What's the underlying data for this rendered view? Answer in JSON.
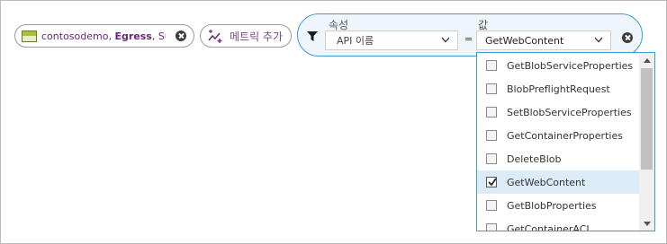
{
  "metric_pill": {
    "resource": "contosodemo, ",
    "metric": "Egress",
    "aggregation": ", Sum",
    "icon": "storage-account-icon",
    "remove_icon": "close-icon"
  },
  "add_metric": {
    "label": "메트릭 추가",
    "icon": "add-metric-sparkle-icon"
  },
  "filter": {
    "icon": "funnel-icon",
    "property_label": "속성",
    "value_label": "값",
    "property_value": "API 이름",
    "operator": "=",
    "value_selected": "GetWebContent",
    "remove_icon": "close-icon"
  },
  "dropdown": {
    "items": [
      {
        "label": "GetBlobServiceProperties",
        "checked": false
      },
      {
        "label": "BlobPreflightRequest",
        "checked": false
      },
      {
        "label": "SetBlobServiceProperties",
        "checked": false
      },
      {
        "label": "GetContainerProperties",
        "checked": false
      },
      {
        "label": "DeleteBlob",
        "checked": false
      },
      {
        "label": "GetWebContent",
        "checked": true
      },
      {
        "label": "GetBlobProperties",
        "checked": false
      },
      {
        "label": "GetContainerACL",
        "checked": false
      }
    ]
  },
  "colors": {
    "accent": "#3e9ad6",
    "metric_text": "#6b2579",
    "selected_row": "#dcebf8"
  }
}
